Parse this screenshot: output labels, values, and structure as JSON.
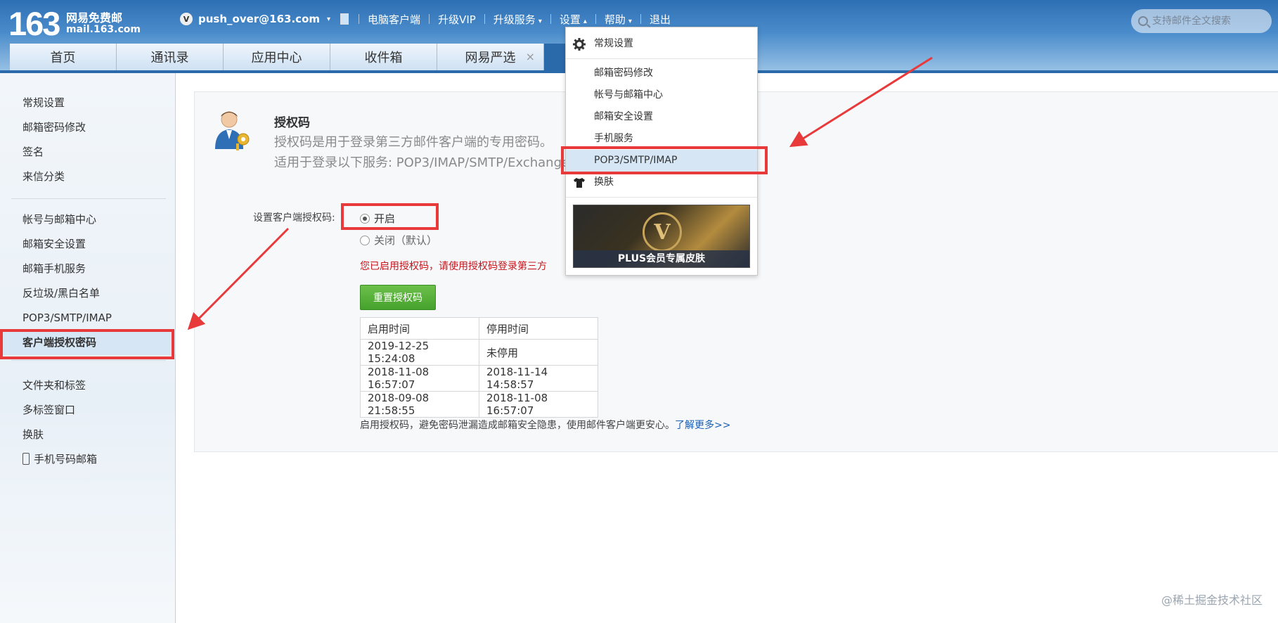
{
  "header": {
    "logo_number": "163",
    "logo_text": "网易免费邮",
    "logo_domain": "mail.163.com",
    "user_badge": "V",
    "account": "push_over@163.com",
    "nav": [
      "电脑客户端",
      "升级VIP",
      "升级服务",
      "设置",
      "帮助",
      "退出"
    ],
    "search_placeholder": "支持邮件全文搜索"
  },
  "tabs": [
    "首页",
    "通讯录",
    "应用中心",
    "收件箱",
    "网易严选"
  ],
  "tab_close": "×",
  "sidebar": {
    "group1": [
      "常规设置",
      "邮箱密码修改",
      "签名",
      "来信分类"
    ],
    "group2": [
      "帐号与邮箱中心",
      "邮箱安全设置",
      "邮箱手机服务",
      "反垃圾/黑白名单",
      "POP3/SMTP/IMAP",
      "客户端授权密码"
    ],
    "group3": [
      "文件夹和标签",
      "多标签窗口",
      "换肤",
      "手机号码邮箱"
    ]
  },
  "auth": {
    "title": "授权码",
    "desc1": "授权码是用于登录第三方邮件客户端的专用密码。",
    "desc2": "适用于登录以下服务: POP3/IMAP/SMTP/Exchange",
    "setting_label": "设置客户端授权码:",
    "option_on": "开启",
    "option_off": "关闭",
    "option_off_default": "（默认）",
    "notice": "您已启用授权码，请使用授权码登录第三方",
    "reset_button": "重置授权码",
    "table_headers": [
      "启用时间",
      "停用时间"
    ],
    "table_rows": [
      [
        "2019-12-25 15:24:08",
        "未停用"
      ],
      [
        "2018-11-08 16:57:07",
        "2018-11-14 14:58:57"
      ],
      [
        "2018-09-08 21:58:55",
        "2018-11-08 16:57:07"
      ]
    ],
    "footnote": "启用授权码，避免密码泄漏造成邮箱安全隐患，使用邮件客户端更安心。",
    "learn_more": "了解更多>>"
  },
  "dropdown": {
    "items": [
      "常规设置",
      "邮箱密码修改",
      "帐号与邮箱中心",
      "邮箱安全设置",
      "手机服务",
      "POP3/SMTP/IMAP",
      "换肤"
    ],
    "promo_letter": "V",
    "promo_caption": "PLUS会员专属皮肤"
  },
  "watermark": "@稀土掘金技术社区",
  "colors": {
    "annotation_red": "#e83a3a",
    "header_blue": "#2d6fb3",
    "highlight": "#d6e6f4",
    "button_green": "#45a22c",
    "notice_red": "#c7161d"
  }
}
